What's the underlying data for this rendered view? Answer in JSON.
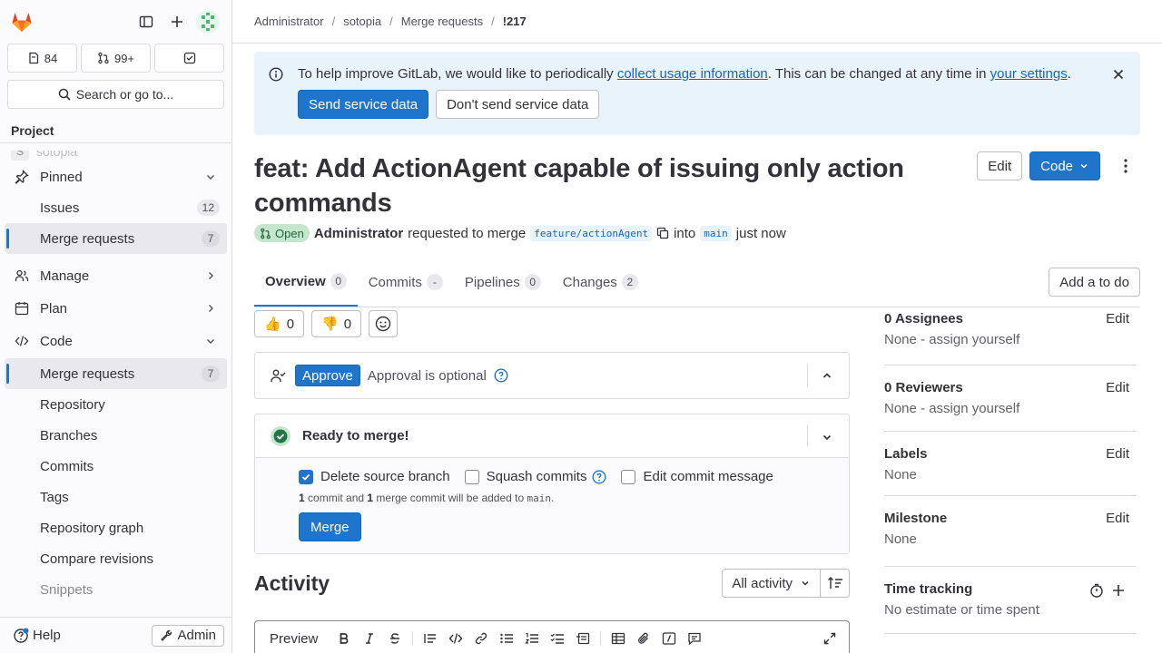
{
  "sidebar": {
    "counters": {
      "issues": "84",
      "merge_requests": "99+"
    },
    "search_label": "Search or go to...",
    "project_heading": "Project",
    "ghost_item": {
      "initial": "S",
      "label": "sotopia"
    },
    "items": [
      {
        "label": "Pinned",
        "type": "section",
        "icon": "pin-icon",
        "chevron": "down"
      },
      {
        "label": "Issues",
        "type": "sub",
        "badge": "12"
      },
      {
        "label": "Merge requests",
        "type": "sub",
        "badge": "7",
        "active": true
      },
      {
        "label": "Manage",
        "type": "section",
        "icon": "users-icon",
        "chevron": "right"
      },
      {
        "label": "Plan",
        "type": "section",
        "icon": "calendar-icon",
        "chevron": "right"
      },
      {
        "label": "Code",
        "type": "section",
        "icon": "code-icon",
        "chevron": "down"
      },
      {
        "label": "Merge requests",
        "type": "sub",
        "badge": "7",
        "active": true
      },
      {
        "label": "Repository",
        "type": "sub"
      },
      {
        "label": "Branches",
        "type": "sub"
      },
      {
        "label": "Commits",
        "type": "sub"
      },
      {
        "label": "Tags",
        "type": "sub"
      },
      {
        "label": "Repository graph",
        "type": "sub"
      },
      {
        "label": "Compare revisions",
        "type": "sub"
      },
      {
        "label": "Snippets",
        "type": "sub",
        "muted": true
      }
    ],
    "help_label": "Help",
    "admin_label": "Admin"
  },
  "breadcrumb": [
    "Administrator",
    "sotopia",
    "Merge requests",
    "!217"
  ],
  "banner": {
    "text_before": "To help improve GitLab, we would like to periodically ",
    "link1": "collect usage information",
    "text_middle": ". This can be changed at any time in ",
    "link2": "your settings",
    "text_after": ".",
    "send_label": "Send service data",
    "dont_send_label": "Don't send service data"
  },
  "mr": {
    "title": "feat: Add ActionAgent capable of issuing only action commands",
    "edit_label": "Edit",
    "code_label": "Code",
    "status": "Open",
    "author": "Administrator",
    "requested_text": "requested to merge",
    "source_branch": "feature/actionAgent",
    "into_text": "into",
    "target_branch": "main",
    "time": "just now"
  },
  "tabs": [
    {
      "label": "Overview",
      "count": "0",
      "active": true
    },
    {
      "label": "Commits",
      "count": "-"
    },
    {
      "label": "Pipelines",
      "count": "0"
    },
    {
      "label": "Changes",
      "count": "2"
    }
  ],
  "todo_label": "Add a to do",
  "reactions": {
    "thumbs_up": "0",
    "thumbs_down": "0"
  },
  "approval": {
    "button": "Approve",
    "text": "Approval is optional"
  },
  "merge": {
    "title": "Ready to merge!",
    "delete_source": "Delete source branch",
    "squash": "Squash commits",
    "edit_message": "Edit commit message",
    "note_n1": "1",
    "note_t1": " commit and ",
    "note_n2": "1",
    "note_t2": " merge commit will be added to ",
    "note_branch": "main",
    "note_end": ".",
    "button": "Merge",
    "delete_checked": true,
    "squash_checked": false,
    "edit_checked": false
  },
  "activity": {
    "title": "Activity",
    "filter": "All activity"
  },
  "editor": {
    "preview_label": "Preview"
  },
  "right_sidebar": {
    "assignees": {
      "title": "0 Assignees",
      "edit": "Edit",
      "value": "None - assign yourself"
    },
    "reviewers": {
      "title": "0 Reviewers",
      "edit": "Edit",
      "value": "None - assign yourself"
    },
    "labels": {
      "title": "Labels",
      "edit": "Edit",
      "value": "None"
    },
    "milestone": {
      "title": "Milestone",
      "edit": "Edit",
      "value": "None"
    },
    "time_tracking": {
      "title": "Time tracking",
      "value": "No estimate or time spent"
    }
  },
  "colors": {
    "primary": "#1f75cb",
    "success_bg": "#c3e6cd",
    "banner_bg": "#e9f3fc",
    "link": "#1068bf"
  }
}
